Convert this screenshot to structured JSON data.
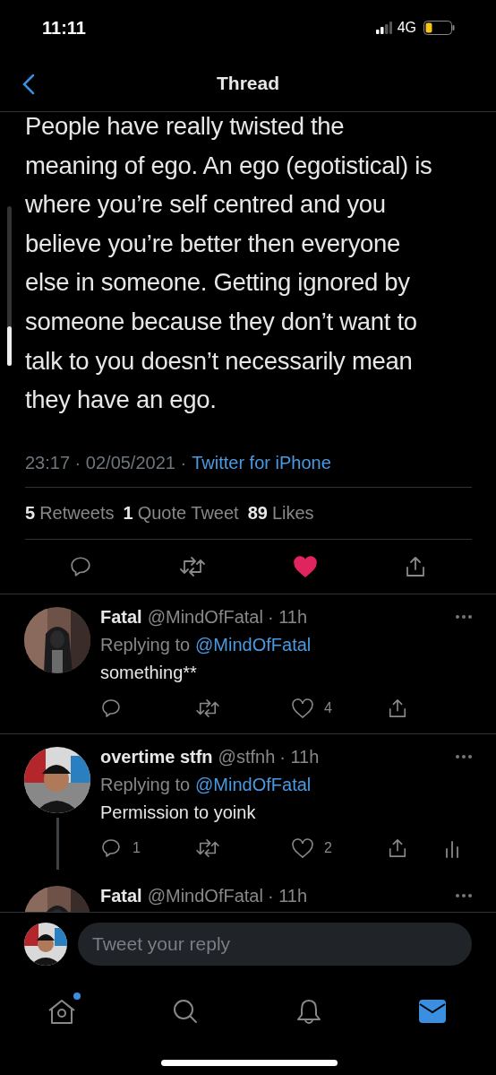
{
  "status_bar": {
    "time": "11:11",
    "network": "4G"
  },
  "header": {
    "title": "Thread"
  },
  "tweet": {
    "text": "People have really twisted the\nmeaning of ego. An ego (egotistical) is\nwhere you’re self centred and you\nbelieve you’re better then everyone\nelse in someone. Getting ignored by\nsomeone because they don’t want to\ntalk to you doesn’t necessarily mean\nthey have an ego.",
    "timestamp": "23:17 · 02/05/2021 ·",
    "source": "Twitter for iPhone",
    "stats": [
      {
        "count": "5",
        "label": "Retweets"
      },
      {
        "count": "1",
        "label": "Quote Tweet"
      },
      {
        "count": "89",
        "label": "Likes"
      }
    ],
    "liked": true
  },
  "replies": [
    {
      "name": "Fatal",
      "handle": "@MindOfFatal",
      "time": "· 11h",
      "replying": "Replying to",
      "mention": "@MindOfFatal",
      "text": "something**",
      "like_count": "4",
      "liked": false,
      "analytics": false,
      "thread_line": false
    },
    {
      "name": "overtime stfn",
      "handle": "@stfnh",
      "time": "· 11h",
      "replying": "Replying to",
      "mention": "@MindOfFatal",
      "text": "Permission to yoink",
      "reply_count": "1",
      "like_count": "2",
      "liked": false,
      "analytics": true,
      "thread_line": true
    },
    {
      "name": "Fatal",
      "handle": "@MindOfFatal",
      "time": "· 11h",
      "thread_line": false
    }
  ],
  "composer": {
    "placeholder": "Tweet your reply"
  },
  "tabs": [
    {
      "kind": "home",
      "selected": false,
      "badge": true
    },
    {
      "kind": "search",
      "selected": false,
      "badge": false
    },
    {
      "kind": "notifications",
      "selected": false,
      "badge": false
    },
    {
      "kind": "messages",
      "selected": true,
      "badge": false
    }
  ]
}
